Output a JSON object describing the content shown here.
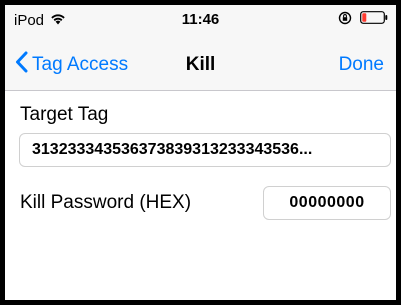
{
  "status_bar": {
    "carrier": "iPod",
    "time": "11:46",
    "wifi_icon": "wifi-icon",
    "lock_icon": "orientation-lock-icon",
    "battery_icon": "battery-low-icon",
    "battery_color": "#ff3b30"
  },
  "nav": {
    "back_label": "Tag Access",
    "title": "Kill",
    "done_label": "Done",
    "accent": "#007aff"
  },
  "form": {
    "target_tag_label": "Target Tag",
    "target_tag_value": "31323334353637383931323334353​6...",
    "kill_password_label": "Kill Password (HEX)",
    "kill_password_value": "00000000"
  }
}
